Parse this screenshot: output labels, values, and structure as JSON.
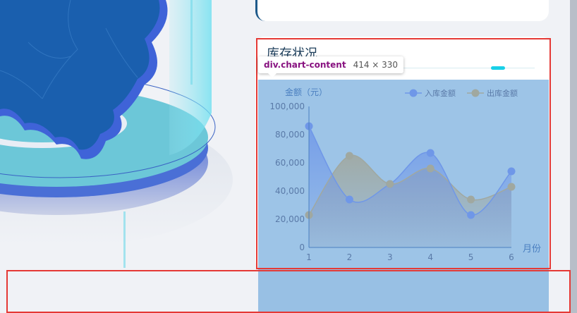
{
  "inventory_card": {
    "title": "库存状况"
  },
  "inspector_tooltip": {
    "tag": "div.chart-content",
    "size": "414 × 330"
  },
  "chart_data": {
    "type": "line",
    "x": [
      1,
      2,
      3,
      4,
      5,
      6
    ],
    "xlabel": "月份",
    "ylabel": "金额（元）",
    "ylim": [
      0,
      100000
    ],
    "yticks": [
      "0",
      "20,000",
      "40,000",
      "60,000",
      "80,000",
      "100,000"
    ],
    "series": [
      {
        "name": "入库金额",
        "values": [
          86000,
          34000,
          45000,
          67000,
          23000,
          54000
        ],
        "color": "#6f97e8"
      },
      {
        "name": "出库金额",
        "values": [
          23000,
          65000,
          45000,
          56000,
          34000,
          43000
        ],
        "color": "#a0a8a0"
      }
    ],
    "legend": "top-right",
    "grid": false
  },
  "colors": {
    "overlay": "#6fa8dc",
    "highlight": "#e53935",
    "accent": "#19d0e8"
  }
}
